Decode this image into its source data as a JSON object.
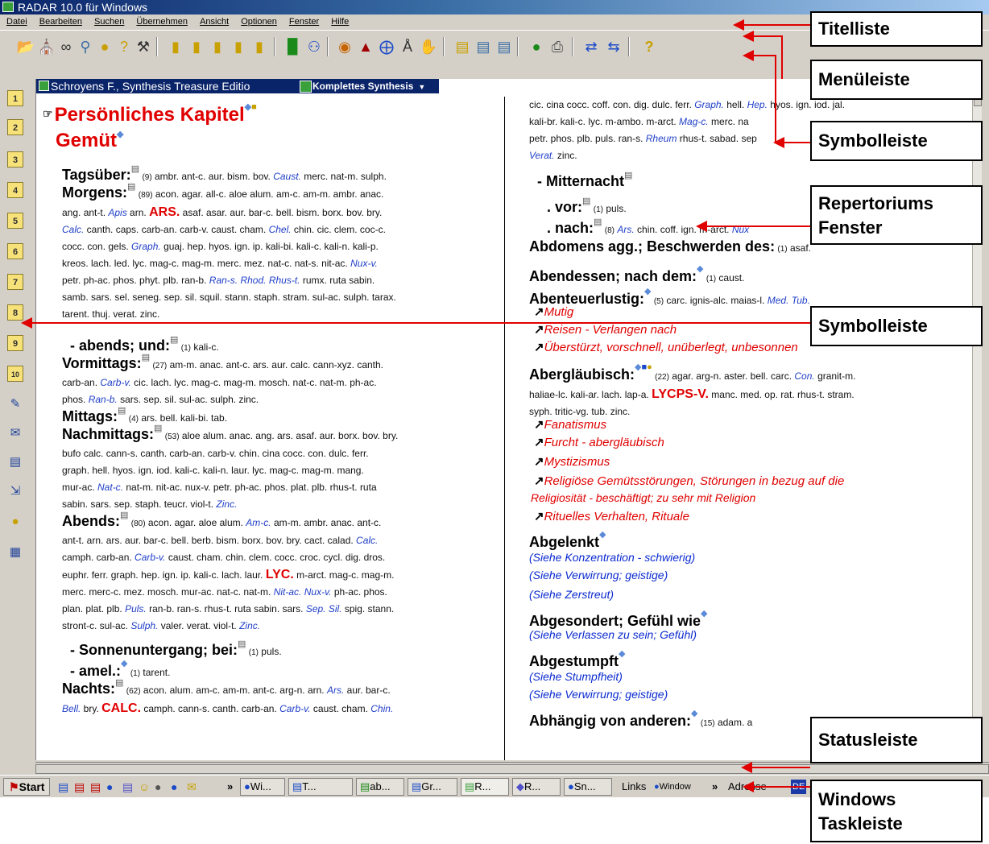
{
  "titlebar": {
    "title": "RADAR 10.0 für Windows"
  },
  "menu": [
    "Datei",
    "Bearbeiten",
    "Suchen",
    "Übernehmen",
    "Ansicht",
    "Optionen",
    "Fenster",
    "Hilfe"
  ],
  "doc": {
    "title": "Schroyens F., Synthesis Treasure Editio",
    "selector": "Komplettes Synthesis"
  },
  "left": {
    "chapter": "Persönliches Kapitel",
    "section": "Gemüt",
    "r1": {
      "head": "Tagsüber:",
      "count": "(9)",
      "text": " ambr. ant-c. aur. bism. bov. ",
      "blue": "Caust.",
      "tail": " merc. nat-m. sulph."
    },
    "r2": {
      "head": "Morgens:",
      "count": "(89)",
      "l1": " acon. agar. all-c. aloe alum. am-c. am-m. ambr. anac.",
      "l2a": "ang. ant-t. ",
      "l2b": "Apis",
      "l2c": " arn. ",
      "l2d": "ARS.",
      "l2e": " asaf. asar. aur. bar-c. bell. bism. borx. bov. bry.",
      "l3a": "Calc.",
      "l3b": " canth. caps. carb-an. carb-v. caust. cham. ",
      "l3c": "Chel.",
      "l3d": " chin. cic. clem. coc-c.",
      "l4a": "cocc. con. gels. ",
      "l4b": "Graph.",
      "l4c": " guaj. hep. hyos. ign. ip. kali-bi. kali-c. kali-n. kali-p.",
      "l5a": "kreos. lach. led. lyc. mag-c. mag-m. merc. mez. nat-c. nat-s. nit-ac. ",
      "l5b": "Nux-v.",
      "l6a": "petr. ph-ac. phos. phyt. plb. ran-b. ",
      "l6b": "Ran-s.",
      "l6c": " ",
      "l6d": "Rhod.",
      "l6e": " ",
      "l6f": "Rhus-t.",
      "l6g": " rumx. ruta sabin.",
      "l7": "samb. sars. sel. seneg. sep. sil. squil. stann. staph. stram. sul-ac. sulph. tarax.",
      "l8": "tarent. thuj. verat. zinc."
    },
    "r3": {
      "head": "- abends; und:",
      "count": "(1)",
      "text": " kali-c."
    },
    "r4": {
      "head": "Vormittags:",
      "count": "(27)",
      "l1": " am-m. anac. ant-c. ars. aur. calc. cann-xyz. canth.",
      "l2a": "carb-an. ",
      "l2b": "Carb-v.",
      "l2c": " cic. lach. lyc. mag-c. mag-m. mosch. nat-c. nat-m. ph-ac.",
      "l3a": "phos. ",
      "l3b": "Ran-b.",
      "l3c": " sars. sep. sil. sul-ac. sulph. zinc."
    },
    "r5": {
      "head": "Mittags:",
      "count": "(4)",
      "text": " ars. bell. kali-bi. tab."
    },
    "r6": {
      "head": "Nachmittags:",
      "count": "(53)",
      "l1": " aloe alum. anac. ang. ars. asaf. aur. borx. bov. bry.",
      "l2": "bufo calc. cann-s. canth. carb-an. carb-v. chin. cina cocc. con. dulc. ferr.",
      "l3": "graph. hell. hyos. ign. iod. kali-c. kali-n. laur. lyc. mag-c. mag-m. mang.",
      "l4a": "mur-ac. ",
      "l4b": "Nat-c.",
      "l4c": " nat-m. nit-ac. nux-v. petr. ph-ac. phos. plat. plb. rhus-t. ruta",
      "l5a": "sabin. sars. sep. staph. teucr. viol-t. ",
      "l5b": "Zinc."
    },
    "r7": {
      "head": "Abends:",
      "count": "(80)",
      "l1a": " acon. agar. aloe alum. ",
      "l1b": "Am-c.",
      "l1c": " am-m. ambr. anac. ant-c.",
      "l2a": "ant-t. arn. ars. aur. bar-c. bell. berb. bism. borx. bov. bry. cact. calad. ",
      "l2b": "Calc.",
      "l3a": "camph. carb-an. ",
      "l3b": "Carb-v.",
      "l3c": " caust. cham. chin. clem. cocc. croc. cycl. dig. dros.",
      "l4": "euphr. ferr. graph. hep. ign. ip. kali-c. lach. laur. ",
      "l4b": "LYC.",
      "l4c": " m-arct. mag-c. mag-m.",
      "l5a": "merc. merc-c. mez. mosch. mur-ac. nat-c. nat-m. ",
      "l5b": "Nit-ac.",
      "l5c": " ",
      "l5d": "Nux-v.",
      "l5e": " ph-ac. phos.",
      "l6a": "plan. plat. plb. ",
      "l6b": "Puls.",
      "l6c": " ran-b. ran-s. rhus-t. ruta sabin. sars. ",
      "l6d": "Sep.",
      "l6e": " ",
      "l6f": "Sil.",
      "l6g": " spig. stann.",
      "l7a": "stront-c. sul-ac. ",
      "l7b": "Sulph.",
      "l7c": " valer. verat. viol-t. ",
      "l7d": "Zinc."
    },
    "r8": {
      "head": "- Sonnenuntergang; bei:",
      "count": "(1)",
      "text": " puls."
    },
    "r9": {
      "head": "- amel.:",
      "count": "(1)",
      "text": " tarent."
    },
    "r10": {
      "head": "Nachts:",
      "count": "(62)",
      "l1a": " acon. alum. am-c. am-m. ant-c. arg-n. arn. ",
      "l1b": "Ars.",
      "l1c": " aur. bar-c.",
      "l2a": "Bell.",
      "l2b": " bry. ",
      "l2c": "CALC.",
      "l2d": " camph. cann-s. canth. carb-an. ",
      "l2e": "Carb-v.",
      "l2f": " caust. cham. ",
      "l2g": "Chin."
    }
  },
  "right": {
    "top": {
      "l1a": "cic. cina cocc. coff. con. dig. dulc. ferr. ",
      "l1b": "Graph.",
      "l1c": " hell. ",
      "l1d": "Hep.",
      "l1e": " hyos. ign. iod. jal.",
      "l2a": "kali-br. kali-c. lyc. m-ambo. m-arct. ",
      "l2b": "Mag-c.",
      "l2c": " merc. na",
      "l3a": "petr. phos. plb. puls. ran-s. ",
      "l3b": "Rheum",
      "l3c": " rhus-t. sabad. sep",
      "l4a": "Verat.",
      "l4b": " zinc."
    },
    "r1": {
      "head": "- Mitternacht"
    },
    "r2": {
      "head": ". vor:",
      "count": "(1)",
      "text": " puls."
    },
    "r3": {
      "head": ". nach:",
      "count": "(8)",
      "a": " ",
      "b": "Ars.",
      "c": " chin. coff. ign. m-arct. ",
      "d": "Nux"
    },
    "r4": {
      "head": "Abdomens agg.; Beschwerden des:",
      "count": "(1)",
      "text": " asaf."
    },
    "r5": {
      "head": "Abendessen; nach dem:",
      "count": "(1)",
      "text": " caust."
    },
    "r6": {
      "head": "Abenteuerlustig:",
      "count": "(5)",
      "text": " carc. ignis-alc. maias-l. ",
      "b1": "Med.",
      "b2": "Tub."
    },
    "links1": [
      "Mutig",
      "Reisen - Verlangen nach",
      "Überstürzt, vorschnell, unüberlegt, unbesonnen"
    ],
    "r7": {
      "head": "Abergläubisch:",
      "count": "(22)",
      "l1a": " agar. arg-n. aster. bell. carc. ",
      "l1b": "Con.",
      "l1c": " granit-m.",
      "l2a": "haliae-lc. kali-ar. lach. lap-a. ",
      "l2b": "LYCPS-V.",
      "l2c": " manc. med. op. rat. rhus-t. stram.",
      "l3": "syph. tritic-vg. tub. zinc."
    },
    "links2": [
      "Fanatismus",
      "Furcht - abergläubisch",
      "Mystizismus",
      "Religiöse Gemütsstörungen, Störungen in bezug auf die",
      "Religiosität - beschäftigt; zu sehr mit Religion",
      "Rituelles Verhalten, Rituale"
    ],
    "r8": {
      "head": "Abgelenkt"
    },
    "see1": [
      "(Siehe Konzentration - schwierig)",
      "(Siehe Verwirrung; geistige)",
      "(Siehe Zerstreut)"
    ],
    "r9": {
      "head": "Abgesondert; Gefühl wie"
    },
    "see2": [
      "(Siehe Verlassen zu sein; Gefühl)"
    ],
    "r10": {
      "head": "Abgestumpft"
    },
    "see3": [
      "(Siehe Stumpfheit)",
      "(Siehe Verwirrung; geistige)"
    ],
    "r11": {
      "head": "Abhängig von anderen:",
      "count": "(15)",
      "text": " adam. a"
    }
  },
  "taskbar": {
    "start": "Start",
    "more": "»",
    "tasks": [
      "Wi...",
      "T...",
      "ab...",
      "Gr...",
      "R...",
      "R...",
      "Sn..."
    ],
    "links": "Links",
    "window": "Window",
    "more2": "»",
    "address": "Adresse",
    "lang": "DE"
  },
  "callouts": {
    "titelliste": "Titelliste",
    "menueleiste": "Menüleiste",
    "symbolleiste1": "Symbolleiste",
    "repertorium": "Repertoriums Fenster",
    "symbolleiste2": "Symbolleiste",
    "statusleiste": "Statusleiste",
    "taskleiste": "Windows Taskleiste"
  },
  "colors": {
    "title_blue": "#0a246a",
    "rubric_red": "#e00000",
    "remedy_blue": "#1f3ec8",
    "crossref_blue": "#0a2ad0",
    "arrow_red": "#e00000"
  },
  "icons": {
    "toolbar": [
      "open-icon",
      "binoculars-icon",
      "glasses-icon",
      "magnifier-icon",
      "bulb-icon",
      "bulb-question-icon",
      "tools-icon",
      "folder-open-icon",
      "folder-add-icon",
      "folder-edit-icon",
      "folder-copy-icon",
      "folder-remove-icon",
      "bar-chart-icon",
      "figure-icon",
      "flask-icon",
      "hat-icon",
      "target-icon",
      "symbol-icon",
      "hand-icon",
      "card-icon",
      "document-icon",
      "list-icon",
      "globe-icon",
      "printer-icon",
      "exchange-left-icon",
      "exchange-right-icon",
      "help-icon"
    ],
    "lefttools": [
      "1",
      "2",
      "3",
      "4",
      "5",
      "6",
      "7",
      "8",
      "9",
      "10"
    ]
  }
}
